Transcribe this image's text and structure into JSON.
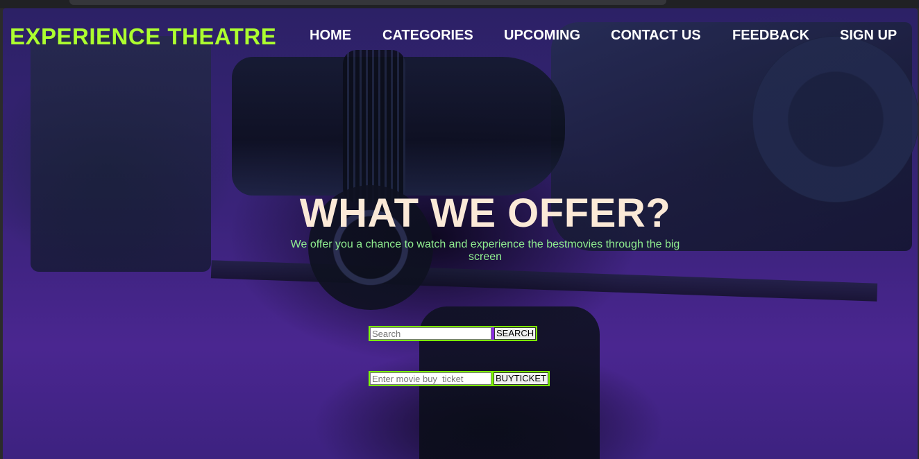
{
  "header": {
    "logo": "EXPERIENCE THEATRE",
    "nav": {
      "home": "HOME",
      "categories": "CATEGORIES",
      "upcoming": "UPCOMING",
      "contact": "CONTACT US",
      "feedback": "FEEDBACK",
      "signup": "SIGN UP"
    }
  },
  "hero": {
    "title": "WHAT WE OFFER?",
    "subtitle": "We offer you a chance to watch and experience the bestmovies through the big screen"
  },
  "search": {
    "placeholder": "Search",
    "button_label": "SEARCH"
  },
  "ticket": {
    "placeholder": "Enter movie buy  ticket",
    "button_label": "BUYTICKET"
  },
  "colors": {
    "logo": "#adff2f",
    "nav_text": "#ffffff",
    "title": "#fbe9d7",
    "subtitle": "#90ee90",
    "form_border": "#7cfc00",
    "search_accent": "#8a2be2",
    "background": "#3a237a"
  }
}
